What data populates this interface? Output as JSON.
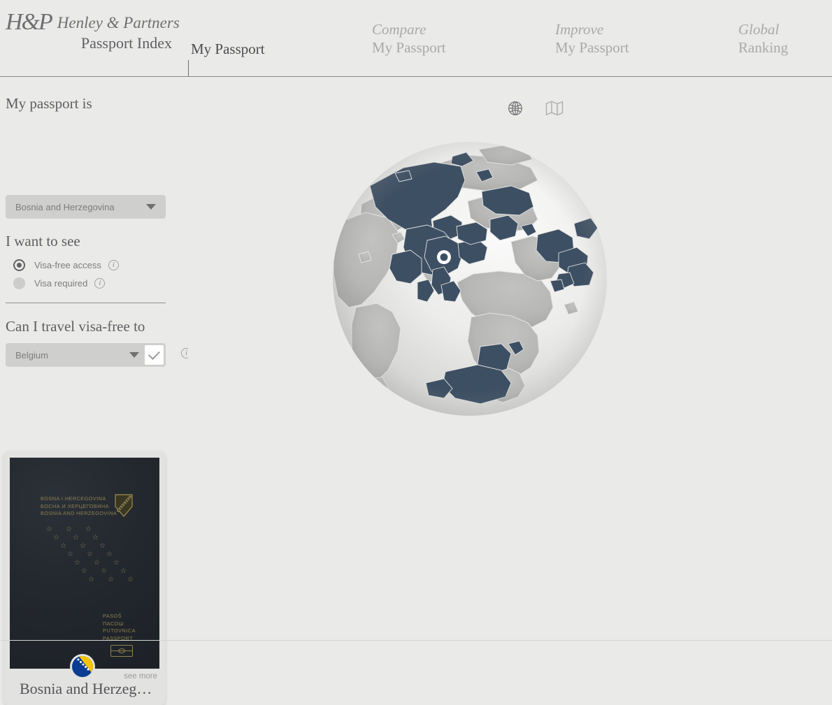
{
  "header": {
    "logo_mark": "H&P",
    "brand_name": "Henley & Partners",
    "brand_sub": "Passport Index",
    "nav": [
      {
        "italic": "",
        "regular": "My Passport",
        "active": true,
        "name": "nav-my-passport"
      },
      {
        "italic": "Compare",
        "regular": "My Passport",
        "active": false,
        "name": "nav-compare-my-passport"
      },
      {
        "italic": "Improve",
        "regular": "My Passport",
        "active": false,
        "name": "nav-improve-my-passport"
      },
      {
        "italic": "Global",
        "regular": "Ranking",
        "active": false,
        "name": "nav-global-ranking"
      }
    ]
  },
  "sidebar": {
    "passport_label": "My passport is",
    "passport_value": "Bosnia and Herzegovina",
    "want_to_see_label": "I want to see",
    "options": [
      {
        "label": "Visa-free access",
        "selected": true
      },
      {
        "label": "Visa required",
        "selected": false
      }
    ],
    "travel_label": "Can I travel visa-free to",
    "destination_value": "Belgium",
    "destination_result": "check",
    "info_icon": "info-icon"
  },
  "card": {
    "title": "Bosnia and Herzeg…",
    "see_more": "see more",
    "passport_cover_lines": [
      "BOSNA I HERCEGOVINA",
      "БОСНА И ХЕРЦЕГОВИНА",
      "BOSNIA AND HERZEGOVINA"
    ],
    "passport_footer_lines": [
      "PASOŠ",
      "ПАСОШ",
      "PUTOVNICA",
      "PASSPORT"
    ],
    "flag": "bosnia-and-herzegovina-flag"
  },
  "main": {
    "view_globe": "globe-icon",
    "view_map": "map-icon",
    "active_view": "globe"
  },
  "colors": {
    "page_bg": "#eaeae8",
    "accent_dark": "#3d4f63",
    "land_gray": "#b7b7b6",
    "ocean_light": "#f0f0ef",
    "dropdown_bg": "#cfcfcd",
    "text_gray": "#6b6b6b",
    "passport_cover": "#23282e",
    "passport_gold": "#8d7f4e",
    "flag_blue": "#0a3d91",
    "flag_yellow": "#f5c400"
  }
}
